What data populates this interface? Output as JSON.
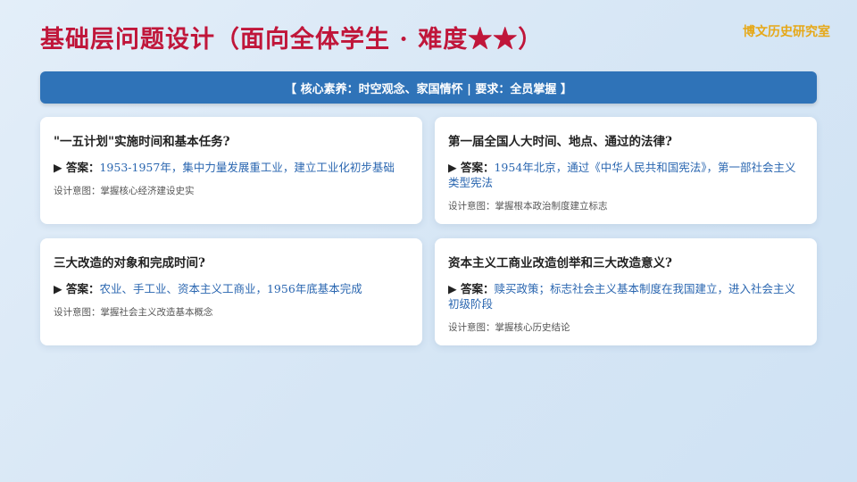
{
  "header": {
    "title": "基础层问题设计（面向全体学生 · 难度★★）",
    "brand": "博文历史研究室"
  },
  "banner": {
    "text": "【 核心素养：时空观念、家国情怀 | 要求：全员掌握 】"
  },
  "cards": [
    {
      "question": "\"一五计划\"实施时间和基本任务?",
      "answer_label": "▶ 答案：",
      "answer": "1953-1957年，集中力量发展重工业，建立工业化初步基础",
      "intent": "设计意图：掌握核心经济建设史实"
    },
    {
      "question": "第一届全国人大时间、地点、通过的法律?",
      "answer_label": "▶ 答案：",
      "answer": "1954年北京，通过《中华人民共和国宪法》，第一部社会主义类型宪法",
      "intent": "设计意图：掌握根本政治制度建立标志"
    },
    {
      "question": "三大改造的对象和完成时间?",
      "answer_label": "▶ 答案：",
      "answer": "农业、手工业、资本主义工商业，1956年底基本完成",
      "intent": "设计意图：掌握社会主义改造基本概念"
    },
    {
      "question": "资本主义工商业改造创举和三大改造意义?",
      "answer_label": "▶ 答案：",
      "answer": "赎买政策；标志社会主义基本制度在我国建立，进入社会主义初级阶段",
      "intent": "设计意图：掌握核心历史结论"
    }
  ],
  "colors": {
    "title": "#c0163a",
    "brand": "#e6a817",
    "banner": "#2f73b8",
    "answer": "#2a66b0"
  }
}
